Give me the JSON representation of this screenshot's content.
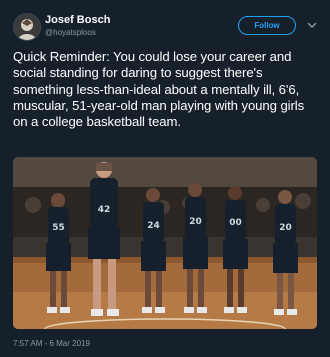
{
  "tweet": {
    "display_name": "Josef Bosch",
    "handle": "@hoyatsploos",
    "follow_label": "Follow",
    "text": "Quick Reminder: You could lose your career and social standing for daring to suggest there's something less-than-ideal about a mentally ill, 6'6, muscular, 51-year-old man playing with young girls on a college basketball team.",
    "timestamp": "7:57 AM - 6 Mar 2019",
    "photo": {
      "jersey_numbers": [
        "55",
        "42",
        "24",
        "20",
        "00",
        "20"
      ]
    }
  },
  "colors": {
    "background": "#15202b",
    "accent": "#1da1f2",
    "secondary_text": "#8899a6",
    "uniform": "#16202c"
  },
  "icons": {
    "avatar": "profile-avatar",
    "menu": "chevron-down-icon"
  }
}
